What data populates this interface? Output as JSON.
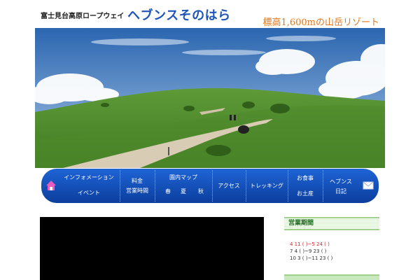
{
  "header": {
    "subtitle": "富士見台高原ロープウェイ",
    "brand": "ヘブンスそのはら",
    "tagline": "標高1,600mの山岳リゾート"
  },
  "nav": {
    "items": [
      {
        "label": "インフォメーション"
      },
      {
        "label": "イベント"
      },
      {
        "label": "料金"
      },
      {
        "label": "営業時間"
      },
      {
        "label": "園内マップ"
      },
      {
        "label": "春"
      },
      {
        "label": "夏"
      },
      {
        "label": "秋"
      },
      {
        "label": "アクセス"
      },
      {
        "label": "トレッキング"
      },
      {
        "label": "お食事"
      },
      {
        "label": "お土産"
      },
      {
        "label": "ヘブンス"
      },
      {
        "label": "日記"
      }
    ]
  },
  "sidebar": {
    "heading": "営業期間",
    "lines": [
      "4 11 ( )~5 24 ( )",
      "7 4 ( )~9 23 ( )",
      "10 3 ( )~11 23 ( )"
    ]
  },
  "colors": {
    "brand": "#1f55b8",
    "tagline": "#e3761c",
    "nav_bg": "#0b4fc4",
    "side_accent": "#9fd18b"
  },
  "icons": {
    "nav_left": "house-icon",
    "nav_right": "mail-icon"
  }
}
